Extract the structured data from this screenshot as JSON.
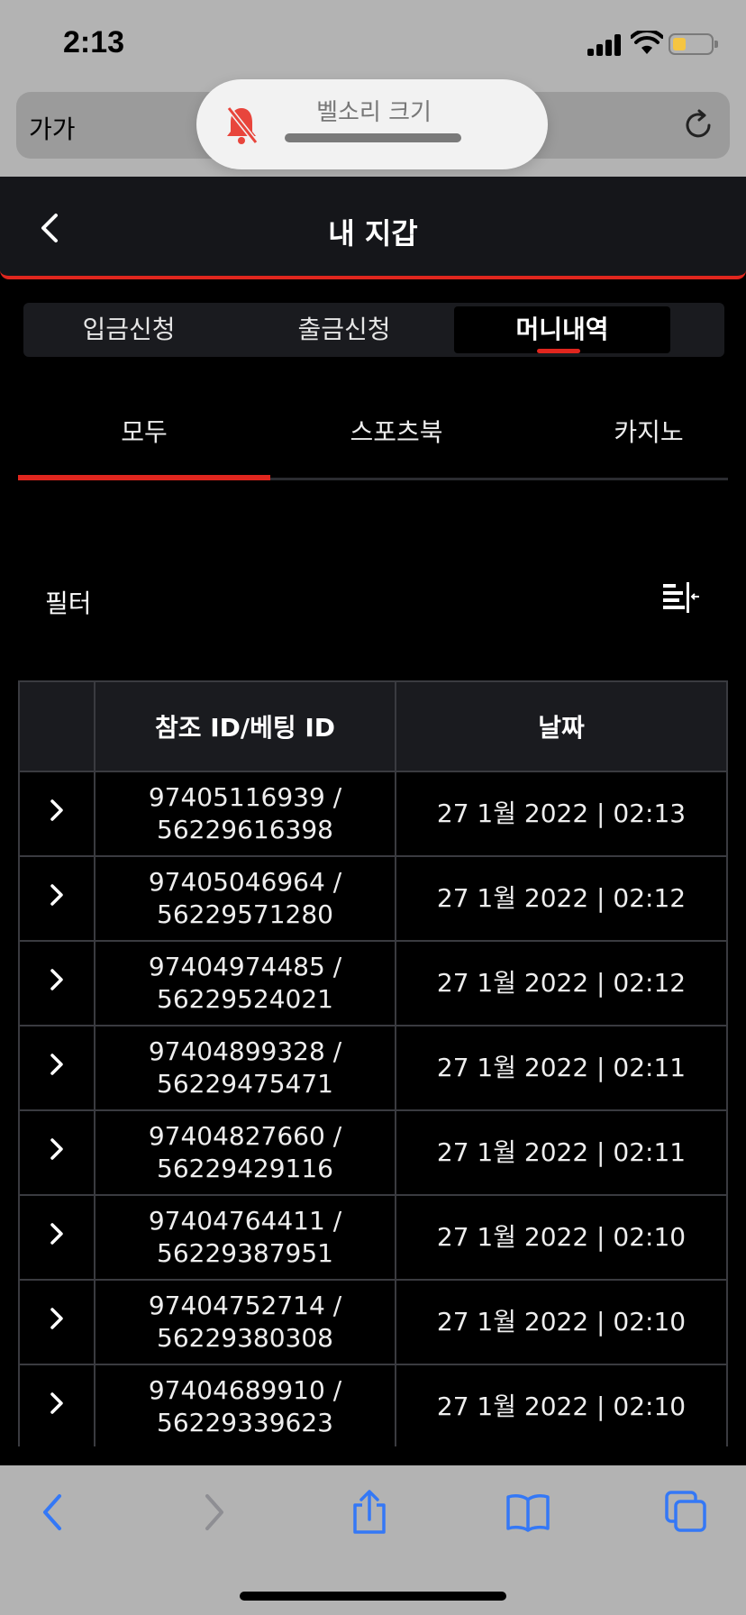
{
  "status_bar": {
    "time": "2:13"
  },
  "browser": {
    "text_size_label": "가가"
  },
  "ringer_hud": {
    "label": "벨소리 크기",
    "muted": true
  },
  "header": {
    "title": "내 지갑"
  },
  "main_tabs": [
    {
      "label": "입금신청",
      "active": false
    },
    {
      "label": "출금신청",
      "active": false
    },
    {
      "label": "머니내역",
      "active": true
    }
  ],
  "sub_tabs": [
    {
      "label": "모두",
      "active": true
    },
    {
      "label": "스포츠북",
      "active": false
    },
    {
      "label": "카지노",
      "active": false
    }
  ],
  "filter": {
    "label": "필터"
  },
  "table": {
    "headers": [
      "",
      "참조 ID/베팅 ID",
      "날짜"
    ],
    "rows": [
      {
        "ref_id": "97405116939 /",
        "bet_id": "56229616398",
        "date": "27 1월 2022 | 02:13"
      },
      {
        "ref_id": "97405046964 /",
        "bet_id": "56229571280",
        "date": "27 1월 2022 | 02:12"
      },
      {
        "ref_id": "97404974485 /",
        "bet_id": "56229524021",
        "date": "27 1월 2022 | 02:12"
      },
      {
        "ref_id": "97404899328 /",
        "bet_id": "56229475471",
        "date": "27 1월 2022 | 02:11"
      },
      {
        "ref_id": "97404827660 /",
        "bet_id": "56229429116",
        "date": "27 1월 2022 | 02:11"
      },
      {
        "ref_id": "97404764411 /",
        "bet_id": "56229387951",
        "date": "27 1월 2022 | 02:10"
      },
      {
        "ref_id": "97404752714 /",
        "bet_id": "56229380308",
        "date": "27 1월 2022 | 02:10"
      },
      {
        "ref_id": "97404689910 /",
        "bet_id": "56229339623",
        "date": "27 1월 2022 | 02:10"
      }
    ]
  },
  "colors": {
    "accent": "#e0261e",
    "header_bg": "#15161a",
    "ios_blue": "#3478f6"
  },
  "icons": {
    "status": [
      "signal-icon",
      "wifi-icon",
      "battery-icon"
    ],
    "bottom_toolbar": [
      "back-icon",
      "forward-icon",
      "share-icon",
      "bookmarks-icon",
      "tabs-icon"
    ]
  }
}
